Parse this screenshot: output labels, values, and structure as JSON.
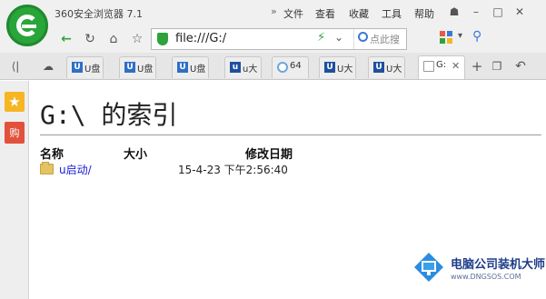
{
  "window": {
    "app_title": "360安全浏览器 7.1",
    "menu": [
      "文件",
      "查看",
      "收藏",
      "工具",
      "帮助"
    ],
    "menu_arrow": "»"
  },
  "toolbar": {
    "url": "file:///G:/",
    "search_placeholder": "点此搜"
  },
  "tabs": [
    {
      "title": "U盘",
      "icon_color": "#2f6fc7"
    },
    {
      "title": "U盘",
      "icon_color": "#2f6fc7"
    },
    {
      "title": "U盘",
      "icon_color": "#2f6fc7"
    },
    {
      "title": "u大",
      "icon_color": "#1f4f9e"
    },
    {
      "title": "64",
      "icon_color": "#6aa8e0"
    },
    {
      "title": "U大",
      "icon_color": "#1f4f9e"
    },
    {
      "title": "U大",
      "icon_color": "#1f4f9e"
    },
    {
      "title": "G:",
      "icon_color": "#ffffff",
      "active": true
    }
  ],
  "page": {
    "heading": "G:\\ 的索引",
    "columns": {
      "name": "名称",
      "size": "大小",
      "modified": "修改日期"
    },
    "rows": [
      {
        "name": "u启动/",
        "size": "",
        "modified": "15-4-23 下午2:56:40"
      }
    ]
  },
  "sidebar": {
    "bag_label": "购"
  },
  "watermark": {
    "title": "电脑公司装机大师",
    "subtitle": "www.DNGSOS.COM"
  }
}
